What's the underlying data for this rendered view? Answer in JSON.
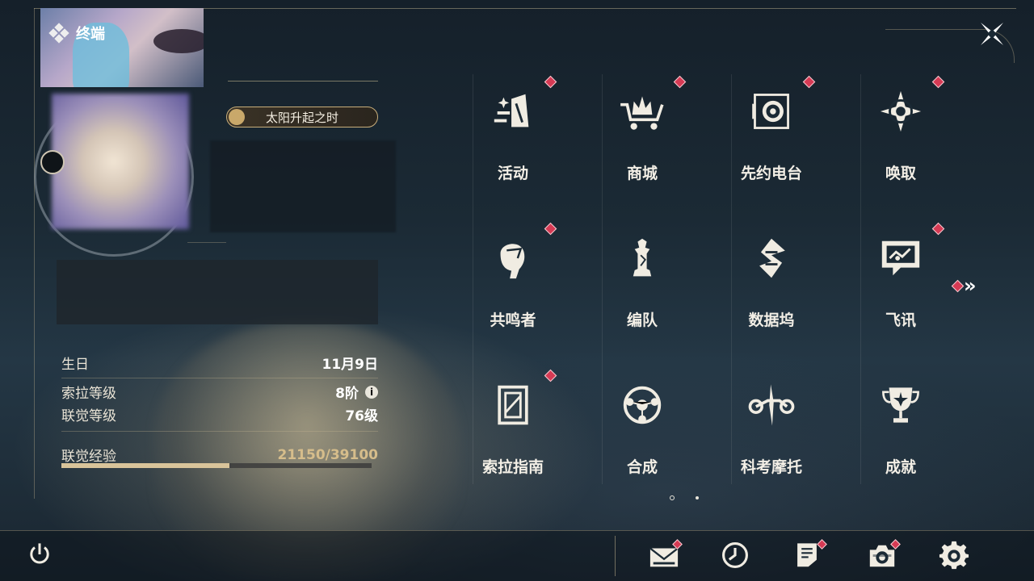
{
  "header": {
    "title": "终端"
  },
  "profile": {
    "title_tag": "太阳升起之时",
    "stats": [
      {
        "label": "生日",
        "value": "11月9日"
      },
      {
        "label": "索拉等级",
        "value": "8阶"
      },
      {
        "label": "联觉等级",
        "value": "76级"
      }
    ],
    "exp": {
      "label": "联觉经验",
      "value": "21150/39100",
      "progress": 0.541
    }
  },
  "grid": {
    "items": [
      {
        "label": "活动",
        "icon": "event-icon",
        "badge": true
      },
      {
        "label": "商城",
        "icon": "shop-crown-icon",
        "badge": true
      },
      {
        "label": "先约电台",
        "icon": "radio-icon",
        "badge": true
      },
      {
        "label": "唤取",
        "icon": "gacha-compass-icon",
        "badge": true
      },
      {
        "label": "共鸣者",
        "icon": "resonator-icon",
        "badge": true
      },
      {
        "label": "编队",
        "icon": "chess-team-icon",
        "badge": false
      },
      {
        "label": "数据坞",
        "icon": "data-dock-icon",
        "badge": false
      },
      {
        "label": "飞讯",
        "icon": "chat-icon",
        "badge": true
      },
      {
        "label": "索拉指南",
        "icon": "guide-icon",
        "badge": true
      },
      {
        "label": "合成",
        "icon": "synthesis-icon",
        "badge": false
      },
      {
        "label": "科考摩托",
        "icon": "motorcycle-icon",
        "badge": false
      },
      {
        "label": "成就",
        "icon": "trophy-icon",
        "badge": false
      }
    ],
    "page_count": 2,
    "current_page": 1
  },
  "bottom_bar": {
    "icons": [
      {
        "name": "power-icon",
        "badge": false
      },
      {
        "name": "mail-icon",
        "badge": true
      },
      {
        "name": "clock-icon",
        "badge": false
      },
      {
        "name": "notes-icon",
        "badge": true
      },
      {
        "name": "camera-icon",
        "badge": true
      },
      {
        "name": "settings-gear-icon",
        "badge": false
      }
    ]
  },
  "colors": {
    "accent_gold": "#d6bd8b",
    "badge_red": "#d63a54",
    "background": "#1b2a35"
  }
}
